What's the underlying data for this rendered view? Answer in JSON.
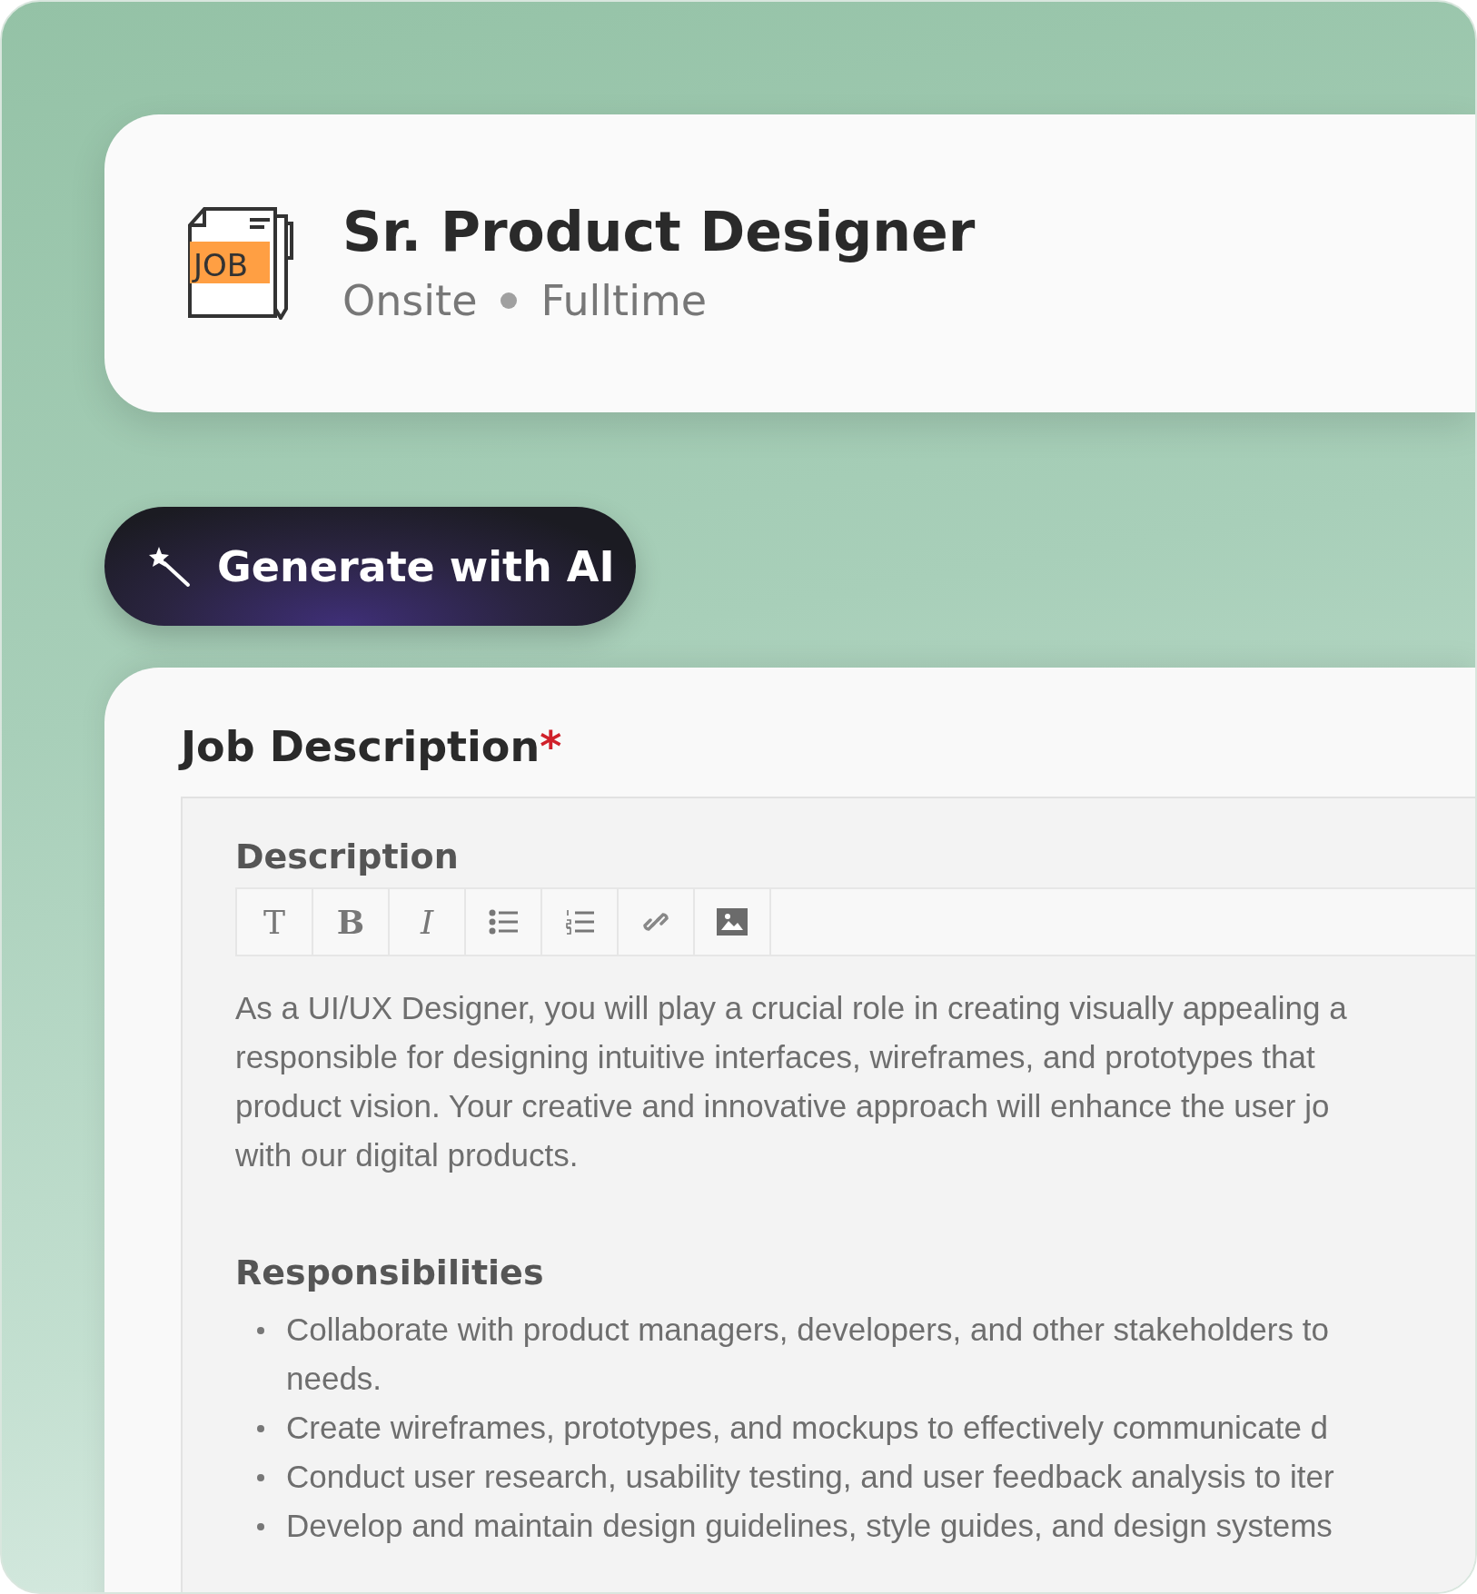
{
  "job": {
    "icon_label": "JOB",
    "title": "Sr. Product Designer",
    "tags": [
      "Onsite",
      "Fulltime"
    ]
  },
  "ai_button": {
    "label": "Generate with AI"
  },
  "job_description": {
    "label": "Job Description",
    "required_mark": "*",
    "editor": {
      "heading": "Description",
      "toolbar": [
        {
          "kind": "text-style",
          "label": "T"
        },
        {
          "kind": "bold",
          "label": "B"
        },
        {
          "kind": "italic",
          "label": "I"
        },
        {
          "kind": "bullet-list"
        },
        {
          "kind": "numbered-list"
        },
        {
          "kind": "link"
        },
        {
          "kind": "image"
        }
      ],
      "paragraph_lines": [
        "As a UI/UX Designer, you will play a crucial role in creating visually appealing a",
        "responsible for designing intuitive interfaces, wireframes, and prototypes that",
        "product vision. Your creative and innovative approach will enhance the user jo",
        "with our digital products."
      ],
      "section_heading": "Responsibilities",
      "bullets": [
        {
          "lines": [
            "Collaborate with product managers, developers, and other stakeholders to",
            "needs."
          ]
        },
        {
          "lines": [
            "Create wireframes, prototypes, and mockups to effectively communicate d"
          ]
        },
        {
          "lines": [
            "Conduct user research, usability testing, and user feedback analysis to iter"
          ]
        },
        {
          "lines": [
            "Develop and maintain design guidelines, style guides, and design systems"
          ]
        }
      ]
    }
  }
}
